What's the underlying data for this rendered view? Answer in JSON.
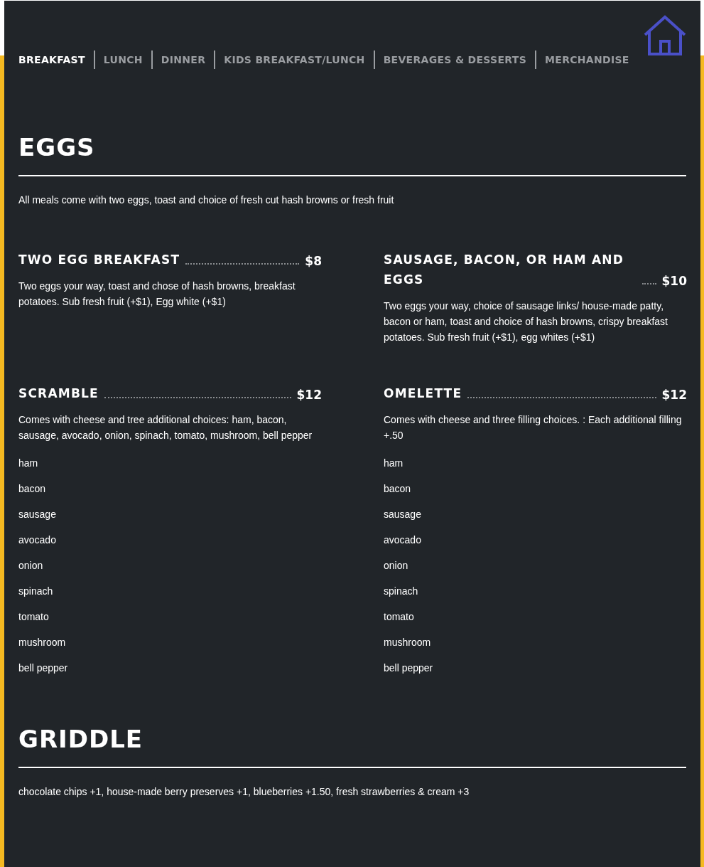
{
  "nav": {
    "tabs": [
      {
        "label": "BREAKFAST",
        "selected": true
      },
      {
        "label": "LUNCH",
        "selected": false
      },
      {
        "label": "DINNER",
        "selected": false
      },
      {
        "label": "KIDS BREAKFAST/LUNCH",
        "selected": false
      },
      {
        "label": "BEVERAGES & DESSERTS",
        "selected": false
      },
      {
        "label": "MERCHANDISE",
        "selected": false
      }
    ]
  },
  "sections": [
    {
      "title": "EGGS",
      "intro": "All meals come with two eggs, toast and choice of fresh cut hash browns or fresh fruit",
      "items": [
        {
          "name": "TWO EGG BREAKFAST",
          "price": "$8",
          "description": "Two eggs your way, toast and chose of hash browns, breakfast potatoes. Sub fresh fruit (+$1), Egg white (+$1)"
        },
        {
          "name": "SAUSAGE, BACON, OR HAM AND EGGS",
          "price": "$10",
          "description": "Two eggs your way, choice of sausage links/ house-made patty, bacon or ham, toast and choice of hash browns, crispy breakfast potatoes. Sub fresh fruit (+$1), egg whites (+$1)"
        },
        {
          "name": "SCRAMBLE",
          "price": "$12",
          "description": "Comes with cheese and tree additional choices: ham, bacon, sausage, avocado, onion, spinach, tomato, mushroom, bell pepper",
          "options": [
            "ham",
            "bacon",
            "sausage",
            "avocado",
            "onion",
            "spinach",
            "tomato",
            "mushroom",
            "bell pepper"
          ]
        },
        {
          "name": "OMELETTE",
          "price": "$12",
          "description": "Comes with cheese and three filling choices. : Each additional filling +.50",
          "options": [
            "ham",
            "bacon",
            "sausage",
            "avocado",
            "onion",
            "spinach",
            "tomato",
            "mushroom",
            "bell pepper"
          ]
        }
      ]
    },
    {
      "title": "GRIDDLE",
      "intro": "chocolate chips +1, house-made berry preserves +1, blueberries +1.50, fresh strawberries & cream +3"
    }
  ]
}
